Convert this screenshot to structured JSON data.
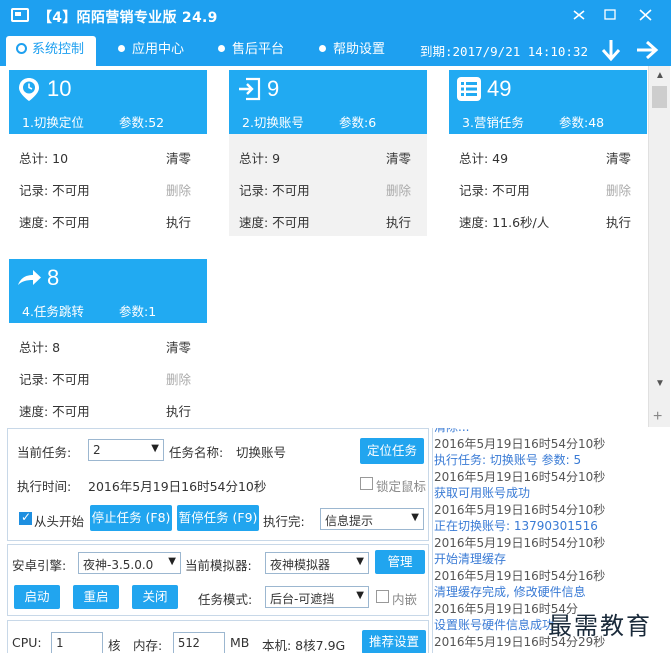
{
  "window": {
    "title": "【4】陌陌营销专业版 24.9",
    "minimize_glyph": "✕",
    "restore_glyph": "—",
    "max_glyph": "□",
    "close_glyph": "✕"
  },
  "nav": {
    "tabs": [
      {
        "label": "系统控制",
        "active": true
      },
      {
        "label": "应用中心",
        "active": false
      },
      {
        "label": "售后平台",
        "active": false
      },
      {
        "label": "帮助设置",
        "active": false
      }
    ],
    "expire": "到期:2017/9/21 14:10:32"
  },
  "cards": [
    {
      "icon": "location-pin-icon",
      "num": "10",
      "name": "1.切换定位",
      "param": "参数:52",
      "rows": [
        {
          "label": "总计: 10",
          "action": "清零",
          "disabled": false
        },
        {
          "label": "记录: 不可用",
          "action": "删除",
          "disabled": true
        },
        {
          "label": "速度: 不可用",
          "action": "执行",
          "disabled": false
        }
      ]
    },
    {
      "icon": "login-icon",
      "num": "9",
      "name": "2.切换账号",
      "param": "参数:6",
      "rows": [
        {
          "label": "总计: 9",
          "action": "清零",
          "disabled": false
        },
        {
          "label": "记录: 不可用",
          "action": "删除",
          "disabled": true
        },
        {
          "label": "速度: 不可用",
          "action": "执行",
          "disabled": false
        }
      ]
    },
    {
      "icon": "list-icon",
      "num": "49",
      "name": "3.营销任务",
      "param": "参数:48",
      "rows": [
        {
          "label": "总计: 49",
          "action": "清零",
          "disabled": false
        },
        {
          "label": "记录: 不可用",
          "action": "删除",
          "disabled": true
        },
        {
          "label": "速度: 11.6秒/人",
          "action": "执行",
          "disabled": false
        }
      ]
    },
    {
      "icon": "share-arrow-icon",
      "num": "8",
      "name": "4.任务跳转",
      "param": "参数:1",
      "rows": [
        {
          "label": "总计: 8",
          "action": "清零",
          "disabled": false
        },
        {
          "label": "记录: 不可用",
          "action": "删除",
          "disabled": true
        },
        {
          "label": "速度: 不可用",
          "action": "执行",
          "disabled": false
        }
      ]
    }
  ],
  "task_panel": {
    "current_task_label": "当前任务:",
    "current_task_value": "2",
    "task_name_label": "任务名称:",
    "task_name_value": "切换账号",
    "locate_button": "定位任务",
    "exec_time_label": "执行时间:",
    "exec_time_value": "2016年5月19日16时54分10秒",
    "lock_mouse_label": "锁定鼠标",
    "lock_mouse_checked": false,
    "from_start_label": "从头开始",
    "from_start_checked": true,
    "stop_button": "停止任务 (F8)",
    "pause_button": "暂停任务 (F9)",
    "done_label": "执行完:",
    "done_value": "信息提示"
  },
  "engine_panel": {
    "engine_label": "安卓引擎:",
    "engine_value": "夜神-3.5.0.0",
    "emulator_label": "当前模拟器:",
    "emulator_value": "夜神模拟器",
    "manage_button": "管理",
    "start_button": "启动",
    "restart_button": "重启",
    "close_button": "关闭",
    "mode_label": "任务模式:",
    "mode_value": "后台-可遮挡",
    "embed_label": "内嵌",
    "embed_checked": false
  },
  "resource_panel": {
    "cpu_label": "CPU:",
    "cpu_value": "1",
    "cpu_unit": "核",
    "mem_label": "内存:",
    "mem_value": "512",
    "mem_unit": "MB",
    "host_label": "本机: 8核7.9G",
    "recommend_button": "推荐设置"
  },
  "log": {
    "lines": [
      {
        "text": "清除...",
        "type": "msg"
      },
      {
        "text": "2016年5月19日16时54分10秒",
        "type": "ts"
      },
      {
        "text": "执行任务: 切换账号 参数: 5",
        "type": "msg"
      },
      {
        "text": "2016年5月19日16时54分10秒",
        "type": "ts"
      },
      {
        "text": "获取可用账号成功",
        "type": "msg"
      },
      {
        "text": "2016年5月19日16时54分10秒",
        "type": "ts"
      },
      {
        "text": "正在切换账号: 13790301516",
        "type": "msg"
      },
      {
        "text": "2016年5月19日16时54分10秒",
        "type": "ts"
      },
      {
        "text": "开始清理缓存",
        "type": "msg"
      },
      {
        "text": "2016年5月19日16时54分16秒",
        "type": "ts"
      },
      {
        "text": "清理缓存完成, 修改硬件信息",
        "type": "msg"
      },
      {
        "text": "2016年5月19日16时54分",
        "type": "ts"
      },
      {
        "text": "设置账号硬件信息成功",
        "type": "msg"
      },
      {
        "text": "2016年5月19日16时54分29秒",
        "type": "ts"
      }
    ]
  },
  "watermark": "最需教育",
  "colors": {
    "accent": "#1ea0f0",
    "card_head": "#21aaf2",
    "log_msg": "#3a7bd5"
  }
}
